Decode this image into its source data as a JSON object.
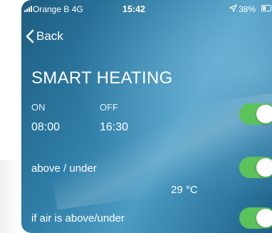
{
  "status_bar": {
    "carrier": "Orange B  4G",
    "time": "15:42",
    "battery": "38%"
  },
  "nav": {
    "back_label": "Back"
  },
  "title": "SMART HEATING",
  "schedule": {
    "on_label": "ON",
    "off_label": "OFF",
    "on_time": "08:00",
    "off_time": "16:30",
    "toggle_on": true
  },
  "threshold": {
    "label": "above / under",
    "value": "29 °C",
    "toggle_on": true
  },
  "air": {
    "label": "if air is above/under",
    "toggle_on": true
  },
  "colors": {
    "toggle_on": "#5cc35a",
    "background": "#2f7da6"
  }
}
